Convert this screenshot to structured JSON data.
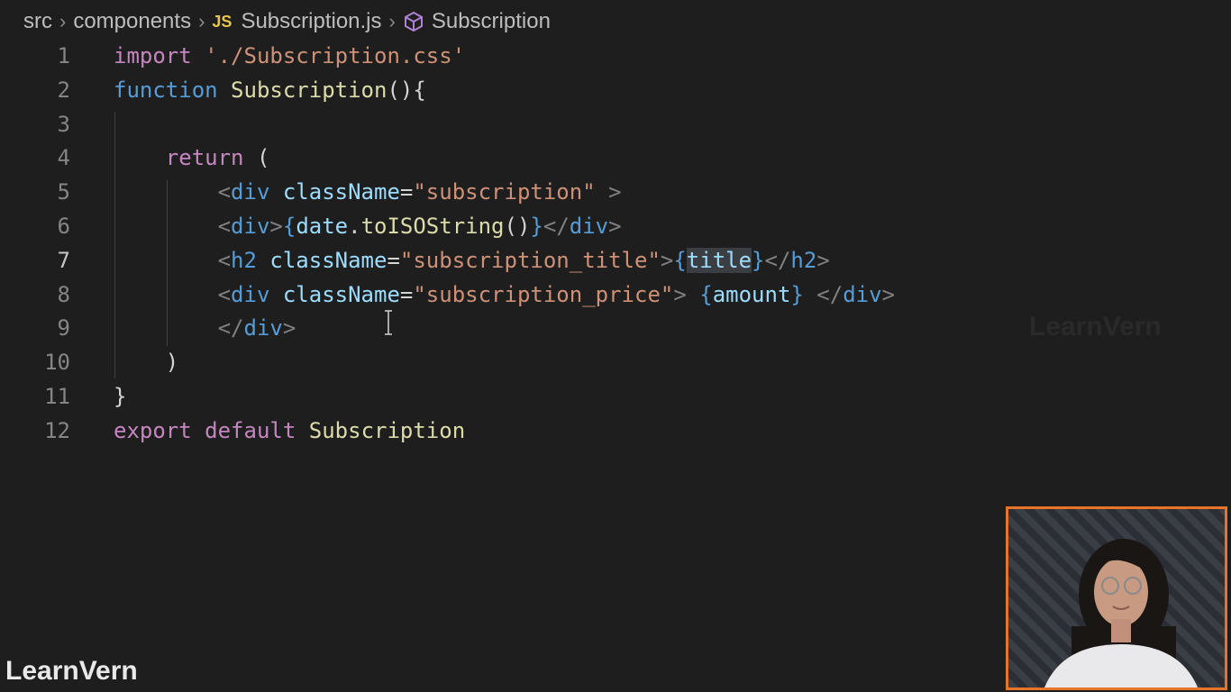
{
  "breadcrumb": {
    "items": [
      "src",
      "components",
      "Subscription.js",
      "Subscription"
    ],
    "file_badge": "JS"
  },
  "editor": {
    "active_line": 7,
    "lines": [
      {
        "number": "1",
        "segments": [
          {
            "t": "import",
            "c": "kw-import"
          },
          {
            "t": " ",
            "c": ""
          },
          {
            "t": "'./Subscription.css'",
            "c": "str"
          }
        ]
      },
      {
        "number": "2",
        "segments": [
          {
            "t": "function",
            "c": "kw-fn"
          },
          {
            "t": " ",
            "c": ""
          },
          {
            "t": "Subscription",
            "c": "fn"
          },
          {
            "t": "(){",
            "c": "paren"
          }
        ]
      },
      {
        "number": "3",
        "segments": []
      },
      {
        "number": "4",
        "segments": [
          {
            "t": "    ",
            "c": ""
          },
          {
            "t": "return",
            "c": "kw-import"
          },
          {
            "t": " (",
            "c": "paren"
          }
        ]
      },
      {
        "number": "5",
        "segments": [
          {
            "t": "        ",
            "c": ""
          },
          {
            "t": "<",
            "c": "punct"
          },
          {
            "t": "div",
            "c": "tag"
          },
          {
            "t": " ",
            "c": ""
          },
          {
            "t": "className",
            "c": "attr"
          },
          {
            "t": "=",
            "c": "paren"
          },
          {
            "t": "\"subscription\"",
            "c": "str"
          },
          {
            "t": " >",
            "c": "punct"
          }
        ]
      },
      {
        "number": "6",
        "segments": [
          {
            "t": "        ",
            "c": ""
          },
          {
            "t": "<",
            "c": "punct"
          },
          {
            "t": "div",
            "c": "tag"
          },
          {
            "t": ">",
            "c": "punct"
          },
          {
            "t": "{",
            "c": "tag"
          },
          {
            "t": "date",
            "c": "var"
          },
          {
            "t": ".",
            "c": "paren"
          },
          {
            "t": "toISOString",
            "c": "fn"
          },
          {
            "t": "()",
            "c": "paren"
          },
          {
            "t": "}",
            "c": "tag"
          },
          {
            "t": "</",
            "c": "punct"
          },
          {
            "t": "div",
            "c": "tag"
          },
          {
            "t": ">",
            "c": "punct"
          }
        ]
      },
      {
        "number": "7",
        "segments": [
          {
            "t": "        ",
            "c": ""
          },
          {
            "t": "<",
            "c": "punct"
          },
          {
            "t": "h2",
            "c": "tag"
          },
          {
            "t": " ",
            "c": ""
          },
          {
            "t": "className",
            "c": "attr"
          },
          {
            "t": "=",
            "c": "paren"
          },
          {
            "t": "\"subscription_title\"",
            "c": "str"
          },
          {
            "t": ">",
            "c": "punct"
          },
          {
            "t": "{",
            "c": "tag"
          },
          {
            "t": "title",
            "c": "var hl"
          },
          {
            "t": "}",
            "c": "tag"
          },
          {
            "t": "</",
            "c": "punct"
          },
          {
            "t": "h2",
            "c": "tag"
          },
          {
            "t": ">",
            "c": "punct"
          }
        ]
      },
      {
        "number": "8",
        "segments": [
          {
            "t": "        ",
            "c": ""
          },
          {
            "t": "<",
            "c": "punct"
          },
          {
            "t": "div",
            "c": "tag"
          },
          {
            "t": " ",
            "c": ""
          },
          {
            "t": "className",
            "c": "attr"
          },
          {
            "t": "=",
            "c": "paren"
          },
          {
            "t": "\"subscription_price\"",
            "c": "str"
          },
          {
            "t": "> ",
            "c": "punct"
          },
          {
            "t": "{",
            "c": "tag"
          },
          {
            "t": "amount",
            "c": "var"
          },
          {
            "t": "}",
            "c": "tag"
          },
          {
            "t": " </",
            "c": "punct"
          },
          {
            "t": "div",
            "c": "tag"
          },
          {
            "t": ">",
            "c": "punct"
          }
        ]
      },
      {
        "number": "9",
        "segments": [
          {
            "t": "        ",
            "c": ""
          },
          {
            "t": "</",
            "c": "punct"
          },
          {
            "t": "div",
            "c": "tag"
          },
          {
            "t": ">",
            "c": "punct"
          }
        ]
      },
      {
        "number": "10",
        "segments": [
          {
            "t": "    ",
            "c": ""
          },
          {
            "t": ")",
            "c": "paren"
          }
        ]
      },
      {
        "number": "11",
        "segments": [
          {
            "t": "}",
            "c": "paren"
          }
        ]
      },
      {
        "number": "12",
        "segments": [
          {
            "t": "export",
            "c": "kw-import"
          },
          {
            "t": " ",
            "c": ""
          },
          {
            "t": "default",
            "c": "kw-import"
          },
          {
            "t": " ",
            "c": ""
          },
          {
            "t": "Subscription",
            "c": "fn"
          }
        ]
      }
    ]
  },
  "watermark": {
    "text": "LearnVern"
  },
  "logo": {
    "text": "LearnVern"
  },
  "colors": {
    "accent_frame": "#e8732a",
    "background": "#1e1e1e"
  }
}
